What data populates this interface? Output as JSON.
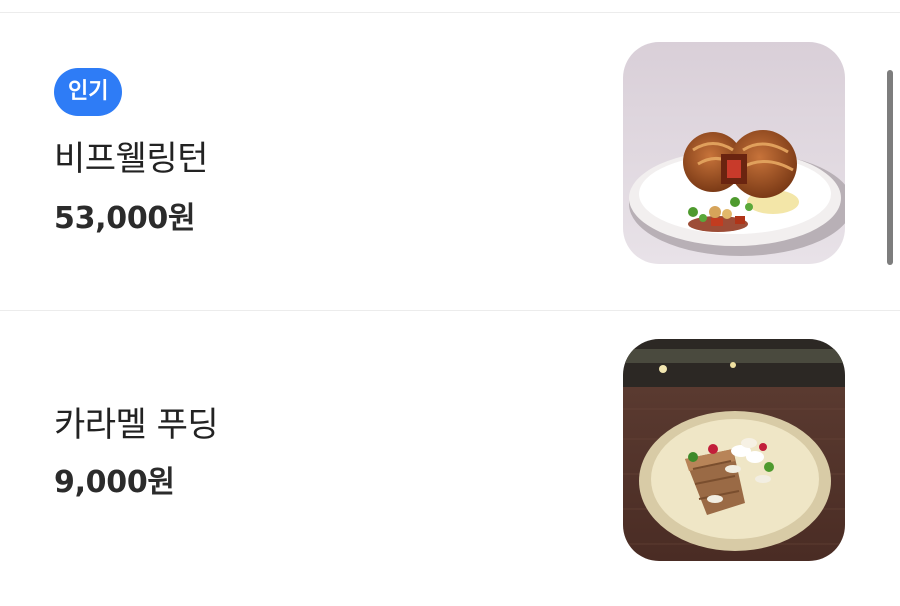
{
  "menu": {
    "items": [
      {
        "badge": "인기",
        "name": "비프웰링턴",
        "price": "53,000원",
        "image_icon": "beef-wellington-photo"
      },
      {
        "name": "카라멜 푸딩",
        "price": "9,000원",
        "image_icon": "caramel-pudding-photo"
      }
    ]
  },
  "colors": {
    "badge_background": "#2e7cf6",
    "badge_text": "#ffffff",
    "divider": "#ececec",
    "scrollbar": "#7d7d7d"
  }
}
